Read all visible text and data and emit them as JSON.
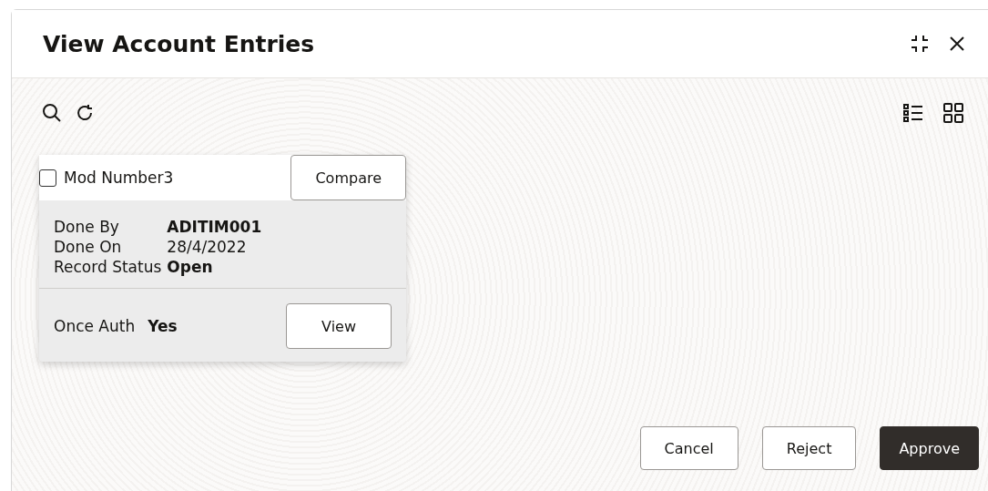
{
  "window": {
    "title": "View Account Entries"
  },
  "card": {
    "checkbox": {
      "label": "Mod Number3",
      "checked": false
    },
    "compare_button": "Compare",
    "details": [
      {
        "label": "Done By",
        "value": "ADITIM001"
      },
      {
        "label": "Done On",
        "value": "28/4/2022"
      },
      {
        "label": "Record Status",
        "value": "Open"
      }
    ],
    "footer": {
      "label": "Once Auth",
      "value": "Yes"
    },
    "view_button": "View"
  },
  "actions": [
    {
      "label": "Cancel",
      "kind": "secondary"
    },
    {
      "label": "Reject",
      "kind": "secondary"
    },
    {
      "label": "Approve",
      "kind": "primary"
    }
  ]
}
